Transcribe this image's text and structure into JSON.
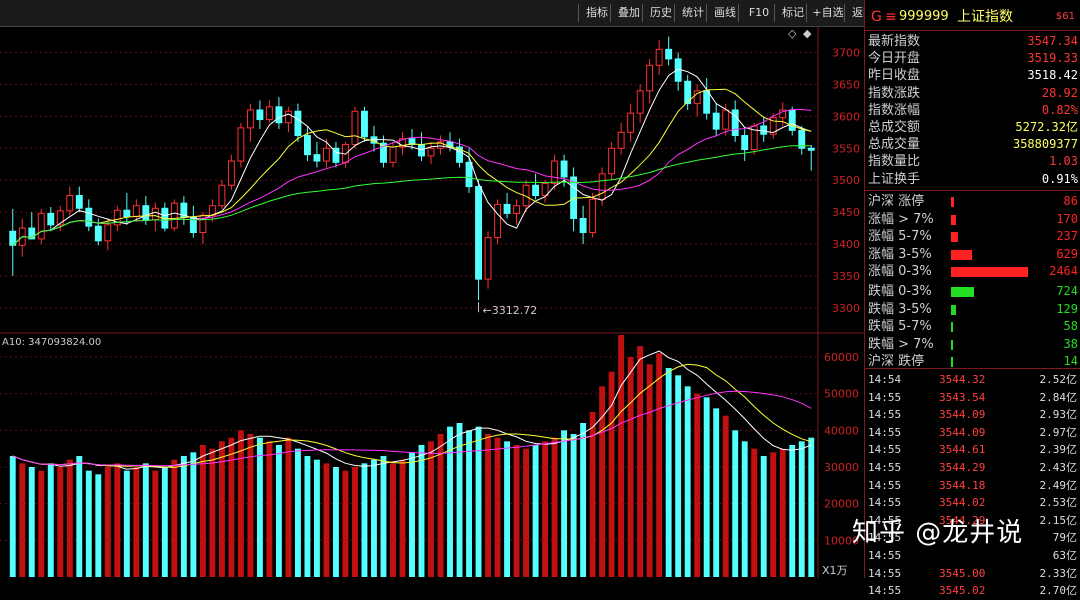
{
  "toolbar": {
    "buttons": [
      "指标",
      "叠加",
      "历史",
      "统计",
      "画线",
      "F10",
      "标记",
      "+自选",
      "返回"
    ],
    "icons": [
      "diamond-outline-icon",
      "diamond-filled-icon"
    ]
  },
  "index_header": {
    "flag": "G",
    "menu_glyph": "≡",
    "code": "999999",
    "name": "上证指数",
    "tag": "$61"
  },
  "quote": [
    {
      "label": "最新指数",
      "value": "3547.34",
      "color": "#ff3333"
    },
    {
      "label": "今日开盘",
      "value": "3519.33",
      "color": "#ff3333"
    },
    {
      "label": "昨日收盘",
      "value": "3518.42",
      "color": "#ffffff"
    },
    {
      "label": "指数涨跌",
      "value": "28.92",
      "color": "#ff3333"
    },
    {
      "label": "指数涨幅",
      "value": "0.82%",
      "color": "#ff3333"
    },
    {
      "label": "总成交额",
      "value": "5272.32亿",
      "color": "#ffff66"
    },
    {
      "label": "总成交量",
      "value": "358809377",
      "color": "#ffff66"
    },
    {
      "label": "指数量比",
      "value": "1.03",
      "color": "#ff3333"
    },
    {
      "label": "上证换手",
      "value": "0.91%",
      "color": "#ffffff"
    }
  ],
  "breadth": [
    {
      "label": "沪深 涨停",
      "value": "86",
      "color": "#ff2222",
      "fill": 0.03
    },
    {
      "label": "涨幅 > 7%",
      "value": "170",
      "color": "#ff2222",
      "fill": 0.05
    },
    {
      "label": "涨幅 5-7%",
      "value": "237",
      "color": "#ff2222",
      "fill": 0.07
    },
    {
      "label": "涨幅 3-5%",
      "value": "629",
      "color": "#ff2222",
      "fill": 0.2
    },
    {
      "label": "涨幅 0-3%",
      "value": "2464",
      "color": "#ff2222",
      "fill": 0.74
    },
    {
      "label": "跌幅 0-3%",
      "value": "724",
      "color": "#22dd22",
      "fill": 0.22
    },
    {
      "label": "跌幅 3-5%",
      "value": "129",
      "color": "#22dd22",
      "fill": 0.05
    },
    {
      "label": "跌幅 5-7%",
      "value": "58",
      "color": "#22dd22",
      "fill": 0.015
    },
    {
      "label": "跌幅 > 7%",
      "value": "38",
      "color": "#22dd22",
      "fill": 0.012
    },
    {
      "label": "沪深 跌停",
      "value": "14",
      "color": "#22dd22",
      "fill": 0.008
    }
  ],
  "ticks": [
    {
      "time": "14:54",
      "price": "3544.32",
      "vol": "2.52亿"
    },
    {
      "time": "14:55",
      "price": "3543.54",
      "vol": "2.84亿"
    },
    {
      "time": "14:55",
      "price": "3544.09",
      "vol": "2.93亿"
    },
    {
      "time": "14:55",
      "price": "3544.09",
      "vol": "2.97亿"
    },
    {
      "time": "14:55",
      "price": "3544.61",
      "vol": "2.39亿"
    },
    {
      "time": "14:55",
      "price": "3544.29",
      "vol": "2.43亿"
    },
    {
      "time": "14:55",
      "price": "3544.18",
      "vol": "2.49亿"
    },
    {
      "time": "14:55",
      "price": "3544.02",
      "vol": "2.53亿"
    },
    {
      "time": "14:55",
      "price": "3544.29",
      "vol": "2.15亿"
    },
    {
      "time": "14:55",
      "price": "",
      "vol": "79亿"
    },
    {
      "time": "14:55",
      "price": "",
      "vol": "63亿"
    },
    {
      "time": "14:55",
      "price": "3545.00",
      "vol": "2.33亿"
    },
    {
      "time": "14:55",
      "price": "3545.02",
      "vol": "2.70亿"
    }
  ],
  "watermark": "知乎 @龙井说",
  "chart_data": {
    "type": "candlestick",
    "price_axis": {
      "ticks": [
        3300,
        3350,
        3400,
        3450,
        3500,
        3550,
        3600,
        3650,
        3700
      ],
      "range": [
        3270,
        3740
      ]
    },
    "volume_axis": {
      "ticks": [
        10000,
        20000,
        30000,
        40000,
        50000,
        60000
      ],
      "unit_label": "X1万",
      "range": [
        0,
        66000
      ]
    },
    "low_annotation": "3312.72",
    "volume_header": "A10: 347093824.00",
    "candles": [
      [
        3420,
        3455,
        3350,
        3398
      ],
      [
        3398,
        3440,
        3380,
        3425
      ],
      [
        3425,
        3450,
        3410,
        3408
      ],
      [
        3408,
        3455,
        3400,
        3448
      ],
      [
        3448,
        3458,
        3420,
        3430
      ],
      [
        3430,
        3460,
        3420,
        3452
      ],
      [
        3452,
        3490,
        3445,
        3476
      ],
      [
        3476,
        3490,
        3450,
        3456
      ],
      [
        3456,
        3470,
        3420,
        3428
      ],
      [
        3428,
        3440,
        3398,
        3405
      ],
      [
        3405,
        3440,
        3390,
        3430
      ],
      [
        3430,
        3460,
        3420,
        3453
      ],
      [
        3453,
        3480,
        3430,
        3443
      ],
      [
        3443,
        3470,
        3435,
        3460
      ],
      [
        3460,
        3475,
        3430,
        3438
      ],
      [
        3438,
        3465,
        3420,
        3456
      ],
      [
        3456,
        3465,
        3420,
        3425
      ],
      [
        3425,
        3470,
        3420,
        3464
      ],
      [
        3464,
        3475,
        3430,
        3442
      ],
      [
        3442,
        3460,
        3410,
        3418
      ],
      [
        3418,
        3450,
        3400,
        3445
      ],
      [
        3445,
        3470,
        3435,
        3460
      ],
      [
        3460,
        3500,
        3455,
        3492
      ],
      [
        3492,
        3540,
        3485,
        3530
      ],
      [
        3530,
        3590,
        3520,
        3582
      ],
      [
        3582,
        3620,
        3560,
        3610
      ],
      [
        3610,
        3625,
        3580,
        3595
      ],
      [
        3595,
        3625,
        3590,
        3615
      ],
      [
        3615,
        3630,
        3580,
        3590
      ],
      [
        3590,
        3615,
        3575,
        3608
      ],
      [
        3608,
        3620,
        3560,
        3570
      ],
      [
        3570,
        3585,
        3530,
        3540
      ],
      [
        3540,
        3560,
        3520,
        3530
      ],
      [
        3530,
        3565,
        3520,
        3550
      ],
      [
        3550,
        3560,
        3520,
        3528
      ],
      [
        3528,
        3560,
        3520,
        3556
      ],
      [
        3556,
        3615,
        3550,
        3608
      ],
      [
        3608,
        3615,
        3560,
        3568
      ],
      [
        3568,
        3585,
        3545,
        3558
      ],
      [
        3558,
        3570,
        3520,
        3528
      ],
      [
        3528,
        3560,
        3520,
        3552
      ],
      [
        3552,
        3575,
        3540,
        3565
      ],
      [
        3565,
        3580,
        3548,
        3556
      ],
      [
        3556,
        3575,
        3530,
        3538
      ],
      [
        3538,
        3560,
        3525,
        3550
      ],
      [
        3550,
        3570,
        3540,
        3560
      ],
      [
        3560,
        3575,
        3545,
        3552
      ],
      [
        3552,
        3565,
        3520,
        3528
      ],
      [
        3528,
        3550,
        3480,
        3490
      ],
      [
        3490,
        3500,
        3312,
        3345
      ],
      [
        3345,
        3420,
        3330,
        3410
      ],
      [
        3410,
        3470,
        3400,
        3462
      ],
      [
        3462,
        3480,
        3440,
        3448
      ],
      [
        3448,
        3470,
        3430,
        3460
      ],
      [
        3460,
        3500,
        3450,
        3492
      ],
      [
        3492,
        3510,
        3470,
        3476
      ],
      [
        3476,
        3500,
        3465,
        3495
      ],
      [
        3495,
        3540,
        3485,
        3530
      ],
      [
        3530,
        3540,
        3490,
        3505
      ],
      [
        3505,
        3520,
        3420,
        3440
      ],
      [
        3440,
        3460,
        3400,
        3418
      ],
      [
        3418,
        3480,
        3410,
        3470
      ],
      [
        3470,
        3520,
        3460,
        3510
      ],
      [
        3510,
        3560,
        3500,
        3550
      ],
      [
        3550,
        3590,
        3540,
        3575
      ],
      [
        3575,
        3620,
        3560,
        3605
      ],
      [
        3605,
        3650,
        3590,
        3640
      ],
      [
        3640,
        3690,
        3620,
        3680
      ],
      [
        3680,
        3720,
        3665,
        3705
      ],
      [
        3705,
        3725,
        3680,
        3690
      ],
      [
        3690,
        3700,
        3640,
        3655
      ],
      [
        3655,
        3665,
        3610,
        3620
      ],
      [
        3620,
        3650,
        3600,
        3640
      ],
      [
        3640,
        3660,
        3595,
        3605
      ],
      [
        3605,
        3620,
        3570,
        3580
      ],
      [
        3580,
        3620,
        3570,
        3610
      ],
      [
        3610,
        3625,
        3560,
        3570
      ],
      [
        3570,
        3580,
        3530,
        3548
      ],
      [
        3548,
        3590,
        3540,
        3585
      ],
      [
        3585,
        3600,
        3560,
        3572
      ],
      [
        3572,
        3605,
        3565,
        3598
      ],
      [
        3598,
        3622,
        3585,
        3610
      ],
      [
        3610,
        3615,
        3570,
        3578
      ],
      [
        3578,
        3585,
        3540,
        3550
      ],
      [
        3550,
        3555,
        3515,
        3547
      ]
    ],
    "volumes": [
      33,
      31,
      30,
      29,
      31,
      30,
      32,
      33,
      29,
      28,
      30,
      31,
      29,
      30,
      31,
      29,
      30,
      32,
      33,
      34,
      36,
      35,
      37,
      38,
      40,
      39,
      38,
      37,
      36,
      38,
      35,
      33,
      32,
      31,
      30,
      29,
      30,
      31,
      32,
      33,
      31,
      32,
      34,
      36,
      37,
      39,
      41,
      42,
      40,
      41,
      39,
      38,
      37,
      36,
      35,
      36,
      37,
      38,
      40,
      39,
      42,
      45,
      52,
      56,
      66,
      60,
      63,
      58,
      61,
      57,
      55,
      52,
      50,
      49,
      46,
      44,
      40,
      37,
      35,
      33,
      34,
      35,
      36,
      37,
      38
    ]
  }
}
